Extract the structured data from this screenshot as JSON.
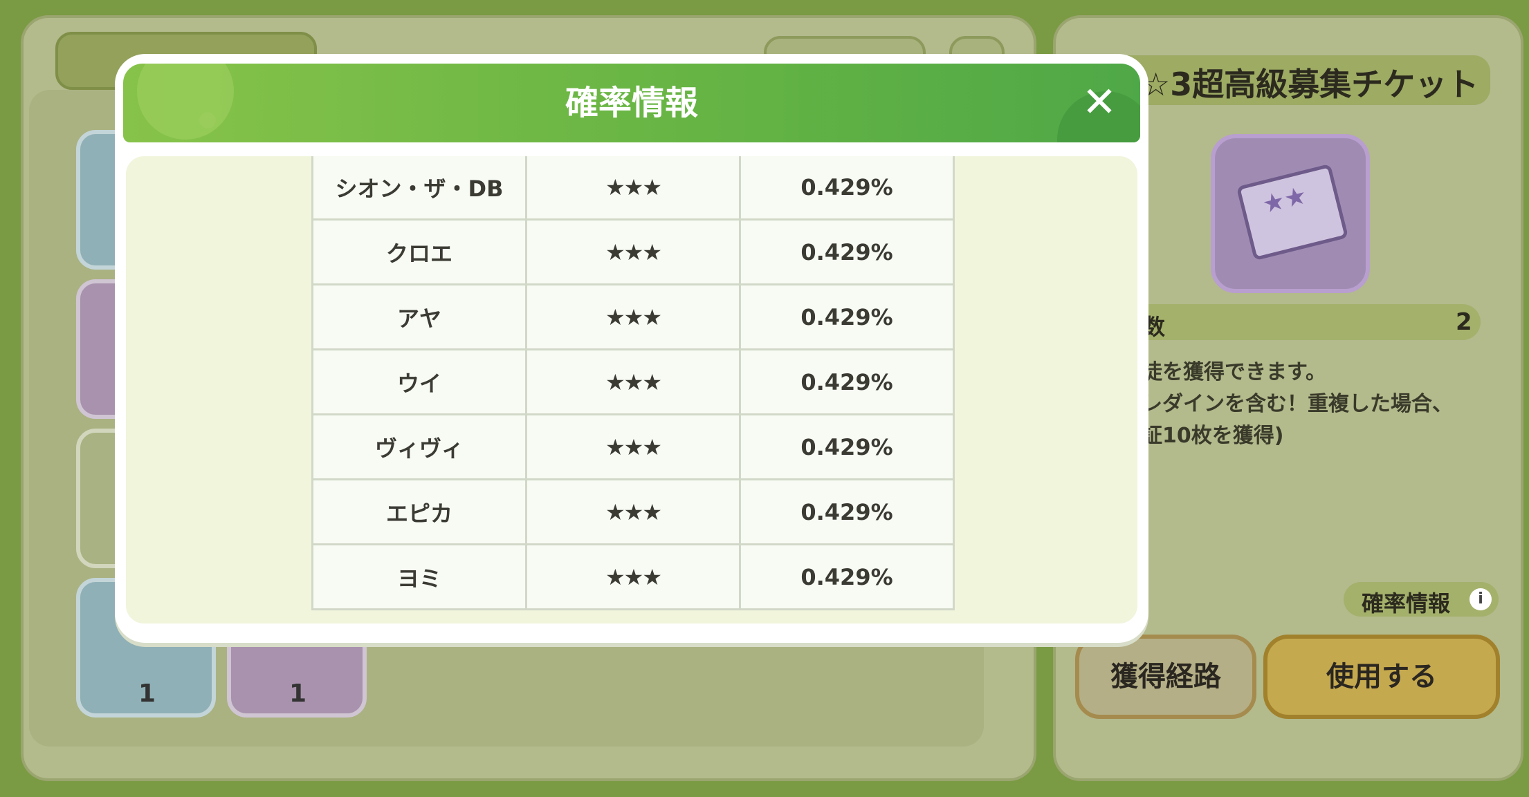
{
  "background": {
    "left_panel": {
      "slots": [
        {
          "count": "1"
        },
        {
          "count": "1"
        }
      ]
    },
    "right_panel": {
      "item_title": "☆3超高級募集チケット",
      "count_label": "数",
      "count_value": "2",
      "description": "徒を獲得できます。\nレダインを含む！重複した場合、\n証10枚を獲得)",
      "rate_info_link": "確率情報",
      "info_icon": "i",
      "acquire_route_button": "獲得経路",
      "use_button": "使用する"
    }
  },
  "modal": {
    "title": "確率情報",
    "close_icon": "✕",
    "rows": [
      {
        "name": "シオン・ザ・DB",
        "rarity": "★★★",
        "rate": "0.429%"
      },
      {
        "name": "クロエ",
        "rarity": "★★★",
        "rate": "0.429%"
      },
      {
        "name": "アヤ",
        "rarity": "★★★",
        "rate": "0.429%"
      },
      {
        "name": "ウイ",
        "rarity": "★★★",
        "rate": "0.429%"
      },
      {
        "name": "ヴィヴィ",
        "rarity": "★★★",
        "rate": "0.429%"
      },
      {
        "name": "エピカ",
        "rarity": "★★★",
        "rate": "0.429%"
      },
      {
        "name": "ヨミ",
        "rarity": "★★★",
        "rate": "0.429%"
      }
    ]
  },
  "colors": {
    "header_green": "#64b344",
    "modal_body": "#f0f5dc",
    "use_button": "#c5a94f"
  }
}
